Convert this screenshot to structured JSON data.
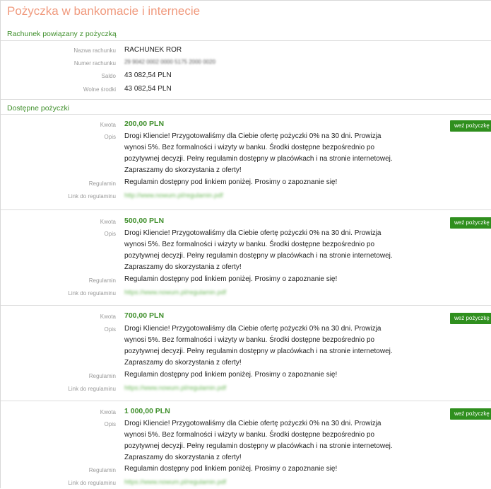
{
  "page": {
    "title": "Pożyczka w bankomacie i internecie"
  },
  "account_section": {
    "header": "Rachunek powiązany z pożyczką",
    "fields": [
      {
        "label": "Nazwa rachunku",
        "value": "RACHUNEK ROR"
      },
      {
        "label": "Numer rachunku",
        "value": "29 9042 0002 0000 5175 2000 0020"
      },
      {
        "label": "Saldo",
        "value": "43 082,54 PLN"
      },
      {
        "label": "Wolne środki",
        "value": "43 082,54 PLN"
      }
    ]
  },
  "loans_section": {
    "header": "Dostępne pożyczki",
    "labels": {
      "amount": "Kwota",
      "description": "Opis",
      "terms": "Regulamin",
      "terms_link": "Link do regulaminu"
    },
    "button_label": "weź pożyczkę",
    "loans": [
      {
        "amount": "200,00 PLN",
        "description": "Drogi Kliencie! Przygotowaliśmy dla Ciebie ofertę pożyczki 0% na 30 dni. Prowizja wynosi 5%. Bez formalności i wizyty w banku. Środki dostępne bezpośrednio po pozytywnej decyzji. Pełny regulamin dostępny w placówkach i na stronie internetowej. Zapraszamy do skorzystania z oferty!",
        "terms": "Regulamin dostępny pod linkiem poniżej. Prosimy o zapoznanie się!",
        "terms_link": "http://www.nowum.pl/regulamin.pdf"
      },
      {
        "amount": "500,00 PLN",
        "description": "Drogi Kliencie! Przygotowaliśmy dla Ciebie ofertę pożyczki 0% na 30 dni. Prowizja wynosi 5%. Bez formalności i wizyty w banku. Środki dostępne bezpośrednio po pozytywnej decyzji. Pełny regulamin dostępny w placówkach i na stronie internetowej. Zapraszamy do skorzystania z oferty!",
        "terms": "Regulamin dostępny pod linkiem poniżej. Prosimy o zapoznanie się!",
        "terms_link": "https://www.nowum.pl/regulamin.pdf"
      },
      {
        "amount": "700,00 PLN",
        "description": "Drogi Kliencie! Przygotowaliśmy dla Ciebie ofertę pożyczki 0% na 30 dni. Prowizja wynosi 5%. Bez formalności i wizyty w banku. Środki dostępne bezpośrednio po pozytywnej decyzji. Pełny regulamin dostępny w placówkach i na stronie internetowej. Zapraszamy do skorzystania z oferty!",
        "terms": "Regulamin dostępny pod linkiem poniżej. Prosimy o zapoznanie się!",
        "terms_link": "https://www.nowum.pl/regulamin.pdf"
      },
      {
        "amount": "1 000,00 PLN",
        "description": "Drogi Kliencie! Przygotowaliśmy dla Ciebie ofertę pożyczki 0% na 30 dni. Prowizja wynosi 5%. Bez formalności i wizyty w banku. Środki dostępne bezpośrednio po pozytywnej decyzji. Pełny regulamin dostępny w placówkach i na stronie internetowej. Zapraszamy do skorzystania z oferty!",
        "terms": "Regulamin dostępny pod linkiem poniżej. Prosimy o zapoznanie się!",
        "terms_link": "https://www.nowum.pl/regulamin.pdf"
      }
    ]
  },
  "colors": {
    "title": "#f09a7e",
    "section_header": "#3f8f2b",
    "amount": "#3f8f2b",
    "button_bg": "#2f8f1e",
    "link": "#6db85a"
  }
}
